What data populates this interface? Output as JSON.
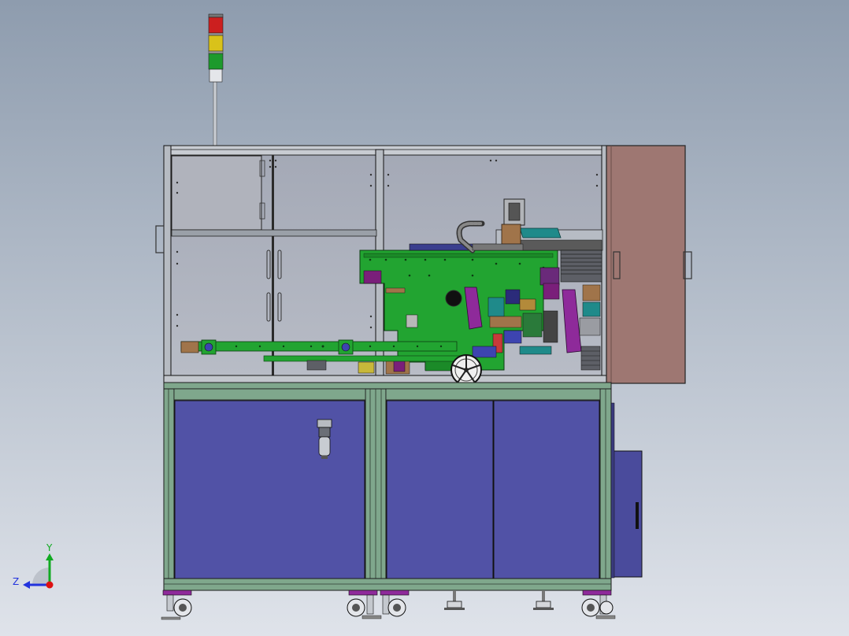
{
  "scene": {
    "background_top": "#8e9cae",
    "background_bottom": "#dfe3ea"
  },
  "triad": {
    "y_label": "Y",
    "z_label": "Z",
    "y_color": "#11aa22",
    "z_color": "#2233dd",
    "origin_color": "#dd1111"
  },
  "colors": {
    "frame_green": "#7fa78c",
    "frame_dark": "#2c3a30",
    "cabinet_blue": "#5152a6",
    "side_panel": "#9e7772",
    "glass": "#a2a8b4",
    "machine_green": "#22a431",
    "machine_purple": "#8e2a9a",
    "machine_teal": "#1f8a8a",
    "machine_brown": "#a0744a",
    "stack_red": "#cc1f1f",
    "stack_yellow": "#d9c21a",
    "stack_green": "#1d9a2c"
  }
}
